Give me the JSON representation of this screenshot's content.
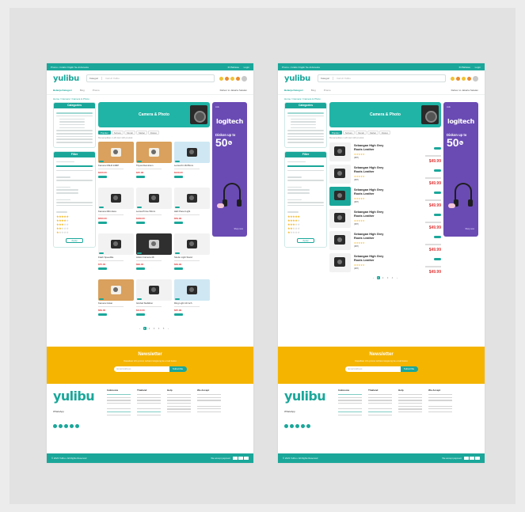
{
  "brand": {
    "logo": "yulibu"
  },
  "topbar": {
    "left": "Promo • Gratis Ongkir Se-Indonesia",
    "right_1": "ID  Bahasa",
    "right_2": "Login"
  },
  "header": {
    "search_category": "Kategori",
    "search_placeholder": "Cari di Yulibu"
  },
  "nav": {
    "browse": "Belanja Kategori",
    "item_1": "Blog",
    "item_2": "Promo",
    "deliver": "Deliver to  Jakarta Selatan"
  },
  "breadcrumb": "Home / Camera / Camera & Photo",
  "sidebar": {
    "categories_title": "Categories",
    "filter_title": "Filter",
    "apply_label": "Apply"
  },
  "banner": {
    "title": "Camera & Photo"
  },
  "tabs": [
    "Populer",
    "Terbaru",
    "Murah",
    "Mahal",
    "Diskon"
  ],
  "result_count": "Menampilkan 1-20 dari 120 produk",
  "grid_products": [
    {
      "name": "Kamera DSLR 24MP",
      "price": "$420.00"
    },
    {
      "name": "Tripod Aluminium",
      "price": "$45.99"
    },
    {
      "name": "Lensa Kit 18-55mm",
      "price": "$129.00"
    },
    {
      "name": "Kamera Mirrorless",
      "price": "$560.00"
    },
    {
      "name": "Lensa Prime 50mm",
      "price": "$189.00"
    },
    {
      "name": "LED Panel Light",
      "price": "$59.99"
    },
    {
      "name": "Flash Speedlite",
      "price": "$75.00"
    },
    {
      "name": "Action Camera 4K",
      "price": "$99.00"
    },
    {
      "name": "Studio Light Stand",
      "price": "$39.99"
    },
    {
      "name": "Kamera Instan",
      "price": "$69.00"
    },
    {
      "name": "Gimbal Stabilizer",
      "price": "$110.00"
    },
    {
      "name": "Ring Light 10 inch",
      "price": "$25.99"
    }
  ],
  "list_products": [
    {
      "title": "Sebangan High Grey Roots Leather",
      "sold": "(987)",
      "price": "$49.99"
    },
    {
      "title": "Sebangan High Grey Roots Leather",
      "sold": "(987)",
      "price": "$49.99"
    },
    {
      "title": "Sebangan High Grey Roots Leather",
      "sold": "(987)",
      "price": "$49.99"
    },
    {
      "title": "Sebangan High Grey Roots Leather",
      "sold": "(987)",
      "price": "$49.99"
    },
    {
      "title": "Sebangan High Grey Roots Leather",
      "sold": "(987)",
      "price": "$49.99"
    },
    {
      "title": "Sebangan High Grey Roots Leather",
      "sold": "(987)",
      "price": "$49.99"
    }
  ],
  "ad": {
    "label": "Ads",
    "brand": "logitech",
    "headline": "Diskon up to",
    "percent": "50",
    "more": "Shop now"
  },
  "pagination": {
    "left": [
      "1",
      "2",
      "3",
      "4",
      "5"
    ],
    "right": [
      "1",
      "2",
      "3",
      "4"
    ]
  },
  "newsletter": {
    "title": "Newsletter",
    "subtitle": "Dapatkan info promo terbaru langsung ke email kamu",
    "placeholder": "Email Address",
    "button": "Subscribe"
  },
  "footer": {
    "whatsapp_label": "WhatsApp",
    "col_1": "Indonesia",
    "col_2": "Thailand",
    "col_3": "Help",
    "col_4": "We Accept",
    "copyright": "© 2023 Yulibu • All Rights Reserved",
    "payment": "We accept payment"
  },
  "colors": {
    "primary": "#1aa79a",
    "accent": "#f4b400",
    "price": "#e23b3b",
    "ad": "#6a4bb4"
  }
}
